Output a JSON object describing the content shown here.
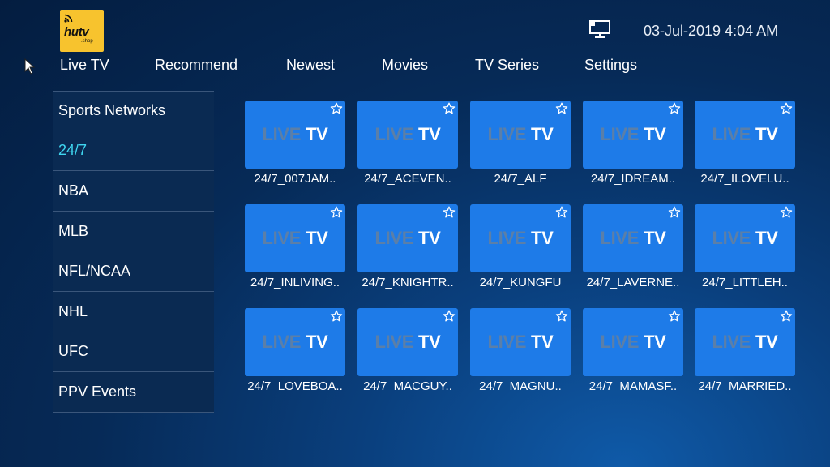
{
  "logo": {
    "brand": "hutv",
    "sub": ".shop"
  },
  "status": {
    "datetime": "03-Jul-2019 4:04 AM"
  },
  "nav": [
    "Live TV",
    "Recommend",
    "Newest",
    "Movies",
    "TV Series",
    "Settings"
  ],
  "sidebar": {
    "active_index": 1,
    "items": [
      "Sports Networks",
      "24/7",
      "NBA",
      "MLB",
      "NFL/NCAA",
      "NHL",
      "UFC",
      "PPV Events"
    ]
  },
  "tile_badge": {
    "live": "LIVE",
    "tv": "TV"
  },
  "channels": [
    "24/7_007JAM..",
    "24/7_ACEVEN..",
    "24/7_ALF",
    "24/7_IDREAM..",
    "24/7_ILOVELU..",
    "24/7_INLIVING..",
    "24/7_KNIGHTR..",
    "24/7_KUNGFU",
    "24/7_LAVERNE..",
    "24/7_LITTLEH..",
    "24/7_LOVEBOA..",
    "24/7_MACGUY..",
    "24/7_MAGNU..",
    "24/7_MAMASF..",
    "24/7_MARRIED.."
  ],
  "colors": {
    "accent": "#3fd6f0",
    "tile": "#1e7be8",
    "logo_bg": "#f7c32e"
  },
  "icons": {
    "tv": "tv-monitor-icon",
    "favorite": "star-outline-icon",
    "cursor": "mouse-pointer-icon"
  }
}
